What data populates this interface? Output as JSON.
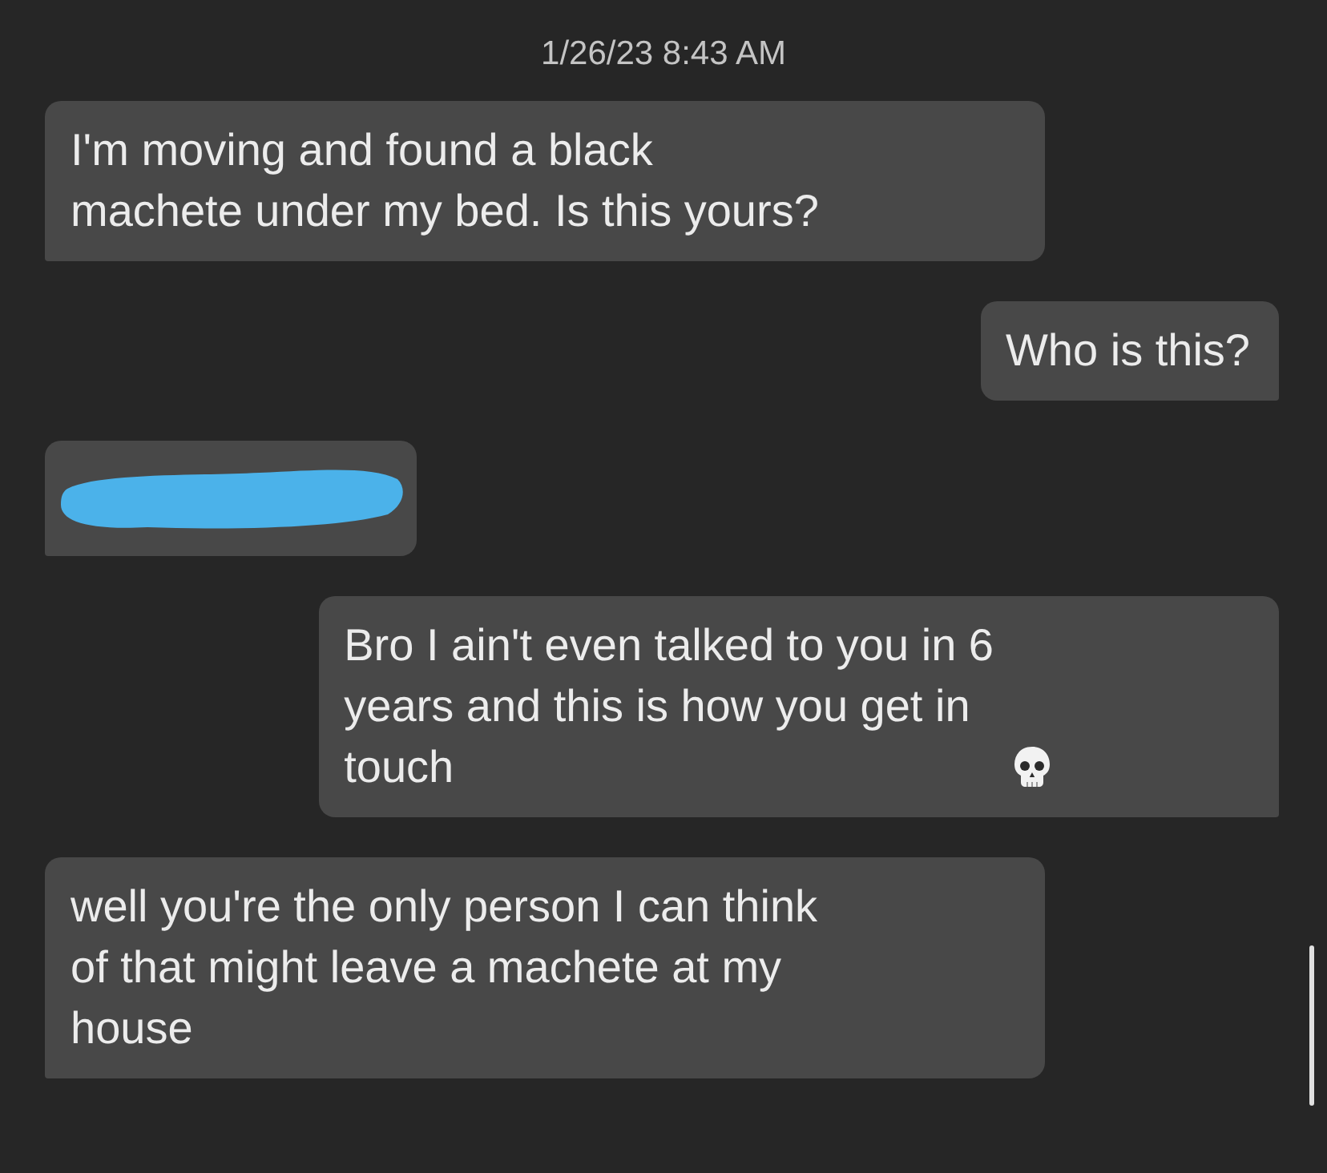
{
  "timestamp": "1/26/23 8:43 AM",
  "messages": [
    {
      "outgoing": false,
      "kind": "text",
      "lines": [
        "I'm moving and found a black",
        "machete under my bed. Is this yours?"
      ],
      "has_emoji": false
    },
    {
      "outgoing": true,
      "kind": "text",
      "lines": [
        "Who is this?"
      ],
      "has_emoji": false
    },
    {
      "outgoing": false,
      "kind": "redacted"
    },
    {
      "outgoing": true,
      "kind": "text",
      "lines": [
        "Bro I ain't even talked to you in 6",
        "years and this is how you get in",
        "touch"
      ],
      "has_emoji": true
    },
    {
      "outgoing": false,
      "kind": "text",
      "lines": [
        "well you're the only person I can think",
        "of that might leave a machete at my",
        "house"
      ],
      "has_emoji": false
    }
  ]
}
